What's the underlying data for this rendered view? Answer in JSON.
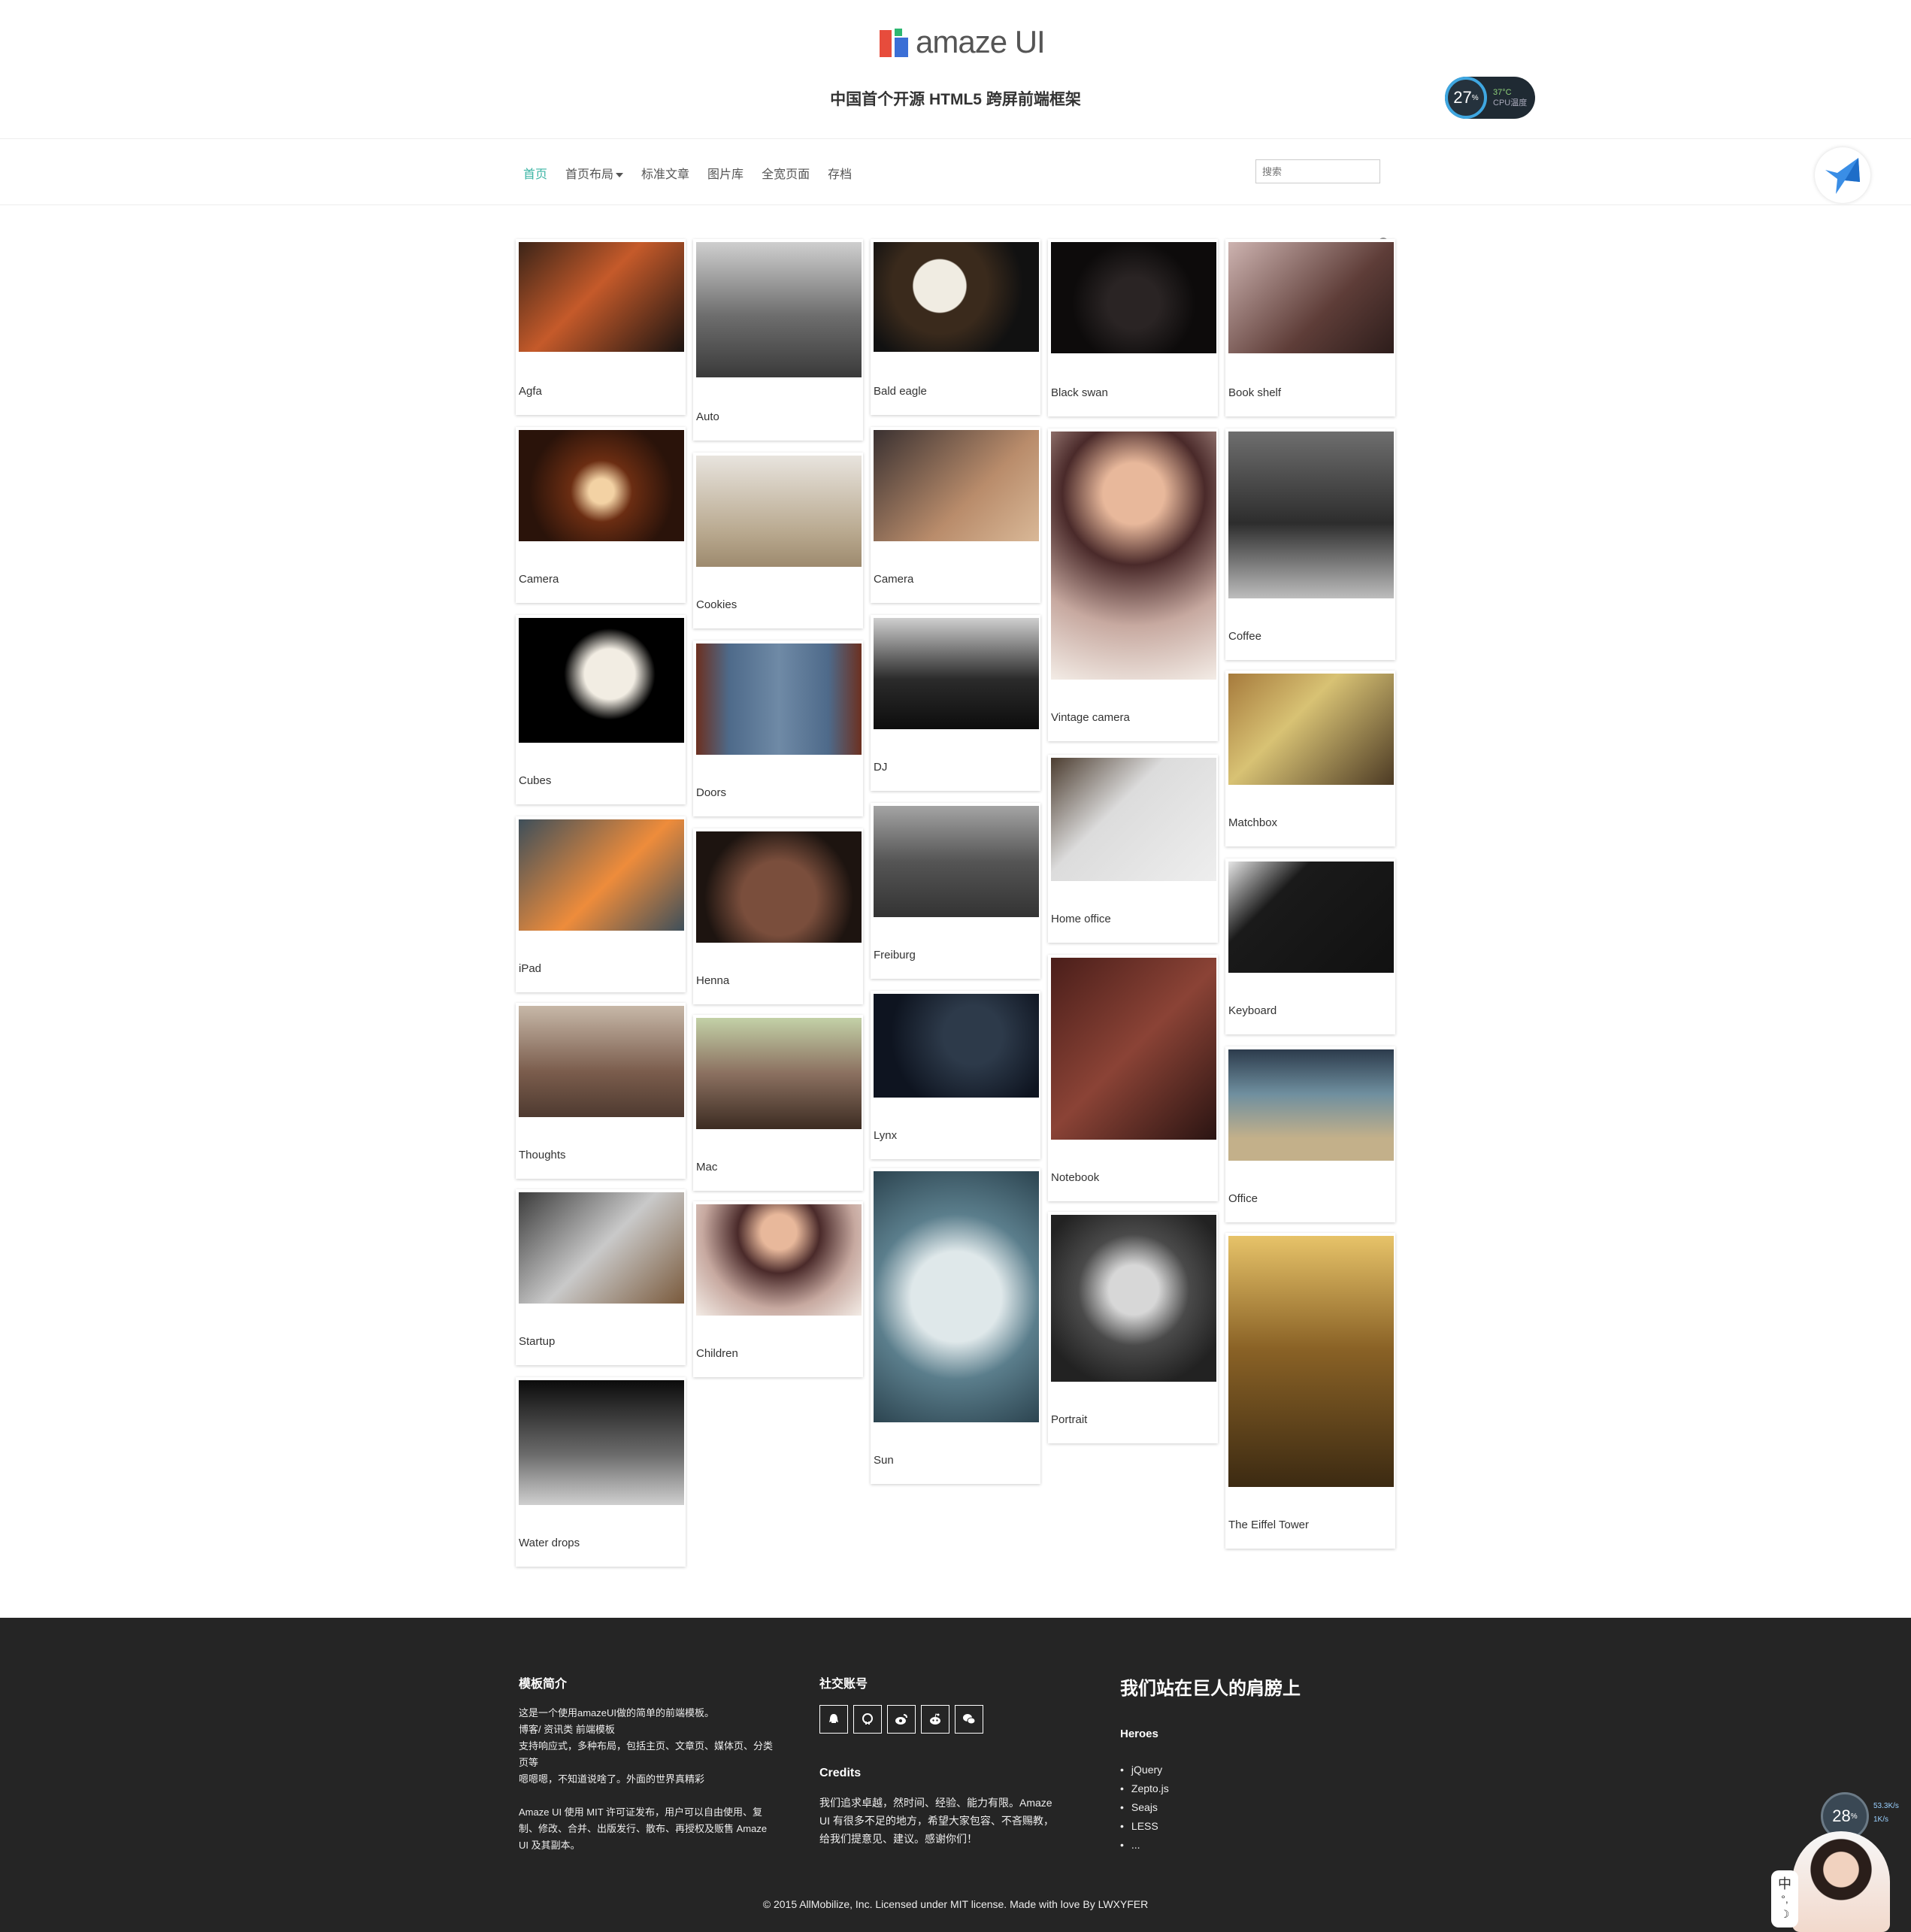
{
  "header": {
    "logo_text": "amaze UI",
    "tagline": "中国首个开源 HTML5 跨屏前端框架",
    "cpu": {
      "percent": "27",
      "unit": "%",
      "temp": "37°C",
      "label": "CPU温度"
    }
  },
  "nav": {
    "items": [
      {
        "label": "首页",
        "active": true
      },
      {
        "label": "首页布局",
        "dropdown": true
      },
      {
        "label": "标准文章"
      },
      {
        "label": "图片库"
      },
      {
        "label": "全宽页面"
      },
      {
        "label": "存档"
      }
    ],
    "search_placeholder": "搜索"
  },
  "gallery": [
    {
      "caption": "Agfa",
      "image": "vintage-camera-reels"
    },
    {
      "caption": "Auto",
      "image": "vintage-car-photo"
    },
    {
      "caption": "Bald eagle",
      "image": "eagle"
    },
    {
      "caption": "Black swan",
      "image": "swan"
    },
    {
      "caption": "Book shelf",
      "image": "shelf"
    },
    {
      "caption": "Camera",
      "image": "camera"
    },
    {
      "caption": "Cookies",
      "image": "cookies"
    },
    {
      "caption": "Camera",
      "image": "camera-2"
    },
    {
      "caption": "Vintage camera",
      "image": "girl"
    },
    {
      "caption": "Coffee",
      "image": "coffee"
    },
    {
      "caption": "Cubes",
      "image": "dice"
    },
    {
      "caption": "Doors",
      "image": "doors"
    },
    {
      "caption": "DJ",
      "image": "dj"
    },
    {
      "caption": "Matchbox",
      "image": "matchbox"
    },
    {
      "caption": "Home office",
      "image": "home-office"
    },
    {
      "caption": "iPad",
      "image": "ipad"
    },
    {
      "caption": "Henna",
      "image": "henna"
    },
    {
      "caption": "Freiburg",
      "image": "street"
    },
    {
      "caption": "Keyboard",
      "image": "keyboard"
    },
    {
      "caption": "Notebook",
      "image": "notebook"
    },
    {
      "caption": "Thoughts",
      "image": "thoughts"
    },
    {
      "caption": "Mac",
      "image": "laptop"
    },
    {
      "caption": "Lynx",
      "image": "lynx"
    },
    {
      "caption": "Office",
      "image": "office"
    },
    {
      "caption": "Portrait",
      "image": "child"
    },
    {
      "caption": "Startup",
      "image": "startup"
    },
    {
      "caption": "Children",
      "image": "girl-2"
    },
    {
      "caption": "Sun",
      "image": "sun"
    },
    {
      "caption": "The Eiffel Tower",
      "image": "eiffel"
    },
    {
      "caption": "Water drops",
      "image": "drops"
    }
  ],
  "footer": {
    "about_title": "模板简介",
    "about_lines": [
      "这是一个使用amazeUI做的简单的前端模板。",
      "博客/ 资讯类 前端模板",
      "支持响应式，多种布局，包括主页、文章页、媒体页、分类",
      "页等",
      "嗯嗯嗯，不知道说啥了。外面的世界真精彩"
    ],
    "license_lines": [
      "Amaze UI 使用 MIT 许可证发布，用户可以自由使用、复",
      "制、修改、合并、出版发行、散布、再授权及贩售 Amaze",
      "UI 及其副本。"
    ],
    "social_title": "社交账号",
    "social_icons": [
      "qq-icon",
      "github-icon",
      "weibo-icon",
      "reddit-icon",
      "wechat-icon"
    ],
    "credits_title": "Credits",
    "credits_lines": [
      "我们追求卓越，然时间、经验、能力有限。Amaze",
      "UI 有很多不足的地方，希望大家包容、不吝赐教，",
      "给我们提意见、建议。感谢你们！"
    ],
    "giants_title": "我们站在巨人的肩膀上",
    "heroes_title": "Heroes",
    "heroes": [
      "jQuery",
      "Zepto.js",
      "Seajs",
      "LESS",
      "..."
    ],
    "copyright": "© 2015 AllMobilize, Inc. Licensed under MIT license. Made with love By LWXYFER"
  },
  "overlay": {
    "net_percent": "28",
    "net_unit": "%",
    "up": "53.3K/s",
    "down": "1K/s",
    "ime_char": "中"
  },
  "colors": {
    "accent": "#3bb4a4",
    "footer_bg": "#252525"
  }
}
